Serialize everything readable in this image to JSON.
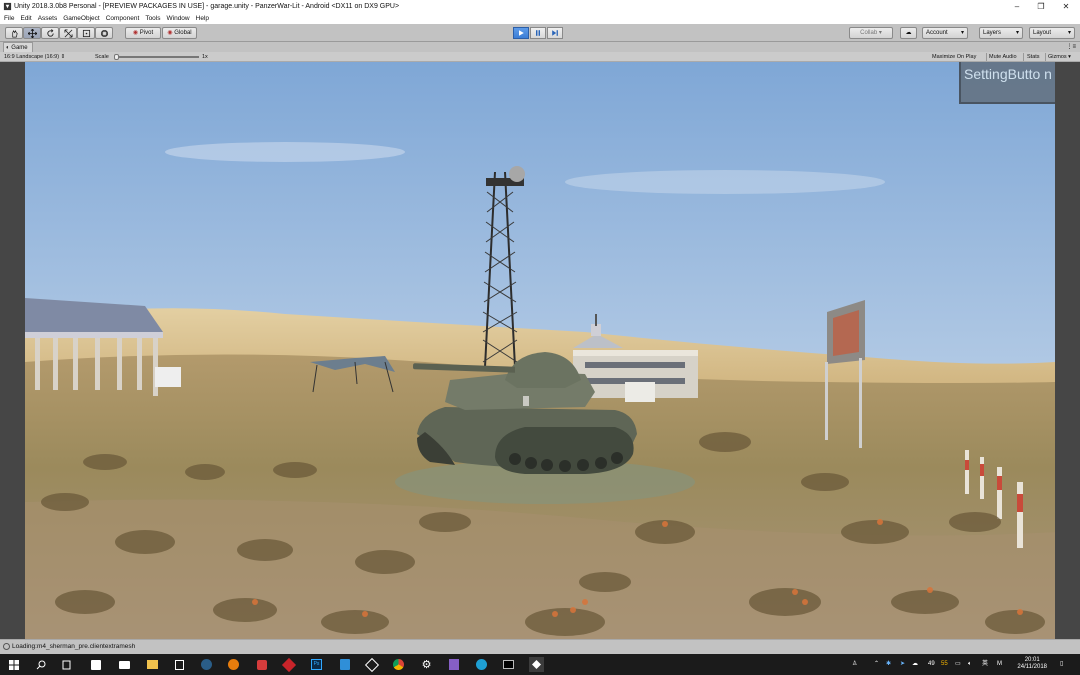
{
  "window": {
    "title": "Unity 2018.3.0b8 Personal - [PREVIEW PACKAGES IN USE] - garage.unity - PanzerWar-Lit - Android <DX11 on DX9 GPU>",
    "minimize": "–",
    "restore": "❐",
    "close": "✕"
  },
  "menu": [
    "File",
    "Edit",
    "Assets",
    "GameObject",
    "Component",
    "Tools",
    "Window",
    "Help"
  ],
  "toolbar": {
    "pivot_label": "Pivot",
    "global_label": "Global",
    "collab_label": "Collab ▾",
    "account_label": "Account",
    "layers_label": "Layers",
    "layout_label": "Layout"
  },
  "game_tab": {
    "label": "Game",
    "aspect_label": "16:9 Landscape (16:9)",
    "scale_label": "Scale",
    "scale_value": "1x",
    "maximize_on_play": "Maximize On Play",
    "mute_audio": "Mute Audio",
    "stats": "Stats",
    "gizmos": "Gizmos"
  },
  "game": {
    "setting_button": "SettingButto n"
  },
  "status": {
    "message": "Loading:m4_sherman_pre.clientextramesh"
  },
  "taskbar": {
    "tray_temp": "49",
    "tray_num": "55",
    "tray_lang": "英",
    "tray_m": "M",
    "time": "20:01",
    "date": "24/11/2018"
  },
  "colors": {
    "accent_play": "#3b7dd6",
    "sky_top": "#8fb4dc",
    "ground": "#9c8a5a"
  }
}
